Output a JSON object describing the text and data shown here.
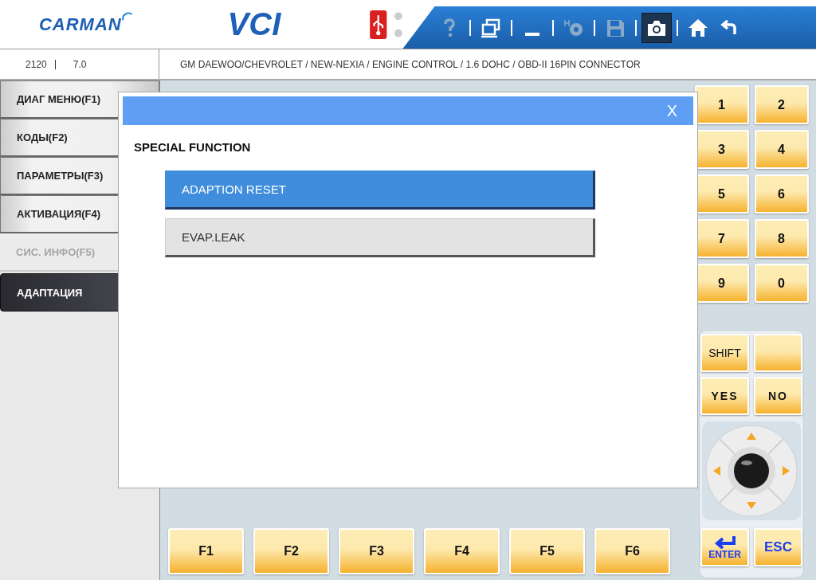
{
  "header": {
    "logo": "CARMAN",
    "product": "VCI",
    "toolbar": [
      {
        "kind": "help",
        "disabled": true,
        "selected": false
      },
      {
        "kind": "windows",
        "disabled": false,
        "selected": false
      },
      {
        "kind": "minimize",
        "disabled": false,
        "selected": false
      },
      {
        "kind": "settings",
        "disabled": true,
        "selected": false
      },
      {
        "kind": "save",
        "disabled": true,
        "selected": false
      },
      {
        "kind": "camera",
        "disabled": false,
        "selected": true
      },
      {
        "kind": "home",
        "disabled": false,
        "selected": false
      },
      {
        "kind": "back",
        "disabled": false,
        "selected": false
      }
    ]
  },
  "info_bar": {
    "code": "2120",
    "version": "7.0",
    "path": "GM DAEWOO/CHEVROLET / NEW-NEXIA / ENGINE CONTROL / 1.6 DOHC / OBD-II 16PIN CONNECTOR"
  },
  "sidebar": {
    "items": [
      {
        "label": "ДИАГ МЕНЮ(F1)",
        "disabled": false,
        "selected": false
      },
      {
        "label": "КОДЫ(F2)",
        "disabled": false,
        "selected": false
      },
      {
        "label": "ПАРАМЕТРЫ(F3)",
        "disabled": false,
        "selected": false
      },
      {
        "label": "АКТИВАЦИЯ(F4)",
        "disabled": false,
        "selected": false
      },
      {
        "label": "СИС. ИНФО(F5)",
        "disabled": true,
        "selected": false
      },
      {
        "label": "АДАПТАЦИЯ",
        "disabled": false,
        "selected": true
      }
    ]
  },
  "dialog": {
    "close": "X",
    "title": "SPECIAL FUNCTION",
    "options": [
      {
        "label": "ADAPTION RESET",
        "selected": true
      },
      {
        "label": "EVAP.LEAK",
        "selected": false
      }
    ]
  },
  "function_keys": [
    "F1",
    "F2",
    "F3",
    "F4",
    "F5",
    "F6"
  ],
  "keypad": {
    "digits": [
      "1",
      "2",
      "3",
      "4",
      "5",
      "6",
      "7",
      "8",
      "9",
      "0"
    ],
    "keys": [
      {
        "kind": "text",
        "label": "SHIFT"
      },
      {
        "kind": "blank"
      },
      {
        "kind": "bold",
        "label": "YES"
      },
      {
        "kind": "bold",
        "label": "NO"
      }
    ],
    "bottom": [
      {
        "kind": "enter",
        "label": "ENTER"
      },
      {
        "kind": "text",
        "label": "ESC"
      }
    ]
  }
}
